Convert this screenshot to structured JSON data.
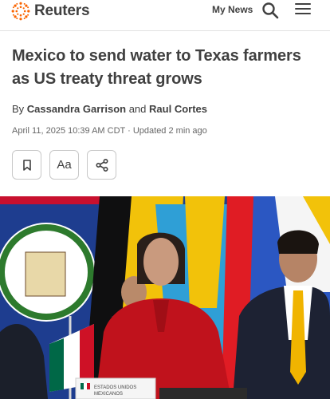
{
  "header": {
    "brand": "Reuters",
    "my_news_label": "My News",
    "search_icon": "search-icon",
    "menu_icon": "hamburger-menu-icon"
  },
  "article": {
    "headline": "Mexico to send water to Texas farmers as US treaty threat grows",
    "byline_prefix": "By",
    "author_1": "Cassandra Garrison",
    "byline_and": "and",
    "author_2": "Raul Cortes",
    "dateline": "April 11, 2025 10:39 AM CDT · Updated 2 min ago"
  },
  "actions": {
    "bookmark_icon": "bookmark-icon",
    "text_size_label": "Aa",
    "share_icon": "share-icon"
  },
  "photo": {
    "placard_line1": "ESTADOS UNIDOS",
    "placard_line2": "MEXICANOS"
  },
  "colors": {
    "brand_orange": "#fa6400",
    "text": "#404040",
    "border": "#c8c8c8"
  }
}
